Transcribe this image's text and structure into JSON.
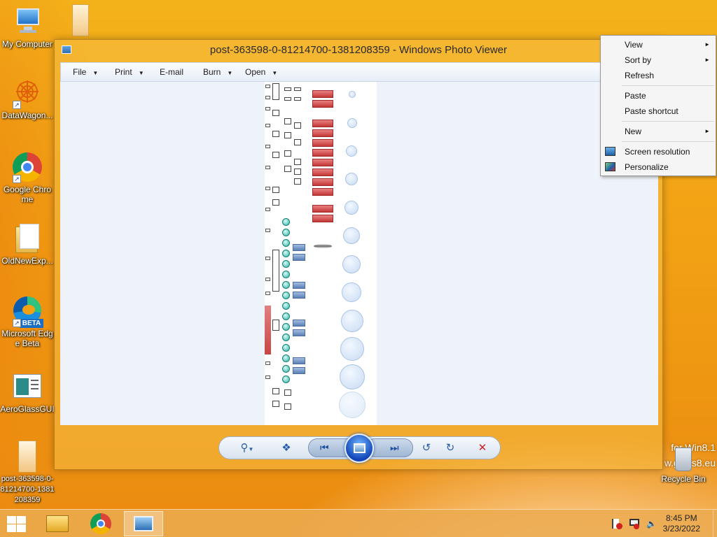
{
  "desktop": {
    "icons": [
      {
        "label": "My Computer"
      },
      {
        "label": "DataWagon..."
      },
      {
        "label": "Google Chrome"
      },
      {
        "label": "OldNewExp..."
      },
      {
        "label": "Microsoft Edge Beta",
        "badge": "BETA"
      },
      {
        "label": "AeroGlassGUI"
      },
      {
        "label": "post-363598-0-81214700-1381208359"
      }
    ],
    "recycle_bin": {
      "label": "Recycle Bin"
    },
    "watermark": {
      "line1": "for Win8.1",
      "line2": "w.glass8.eu"
    }
  },
  "photo_viewer": {
    "title": "post-363598-0-81214700-1381208359 - Windows Photo Viewer",
    "menu": {
      "file": "File",
      "print": "Print",
      "email": "E-mail",
      "burn": "Burn",
      "open": "Open"
    },
    "controls": {
      "zoom_icon": "zoom-icon",
      "actual_size_icon": "actual-size-icon",
      "previous_icon": "previous-icon",
      "slideshow_icon": "slideshow-icon",
      "next_icon": "next-icon",
      "rotate_ccw_icon": "rotate-counterclockwise-icon",
      "rotate_cw_icon": "rotate-clockwise-icon",
      "delete_icon": "delete-icon"
    }
  },
  "context_menu": {
    "view": "View",
    "sort_by": "Sort by",
    "refresh": "Refresh",
    "paste": "Paste",
    "paste_shortcut": "Paste shortcut",
    "new": "New",
    "screen_resolution": "Screen resolution",
    "personalize": "Personalize"
  },
  "taskbar": {
    "time": "8:45 PM",
    "date": "3/23/2022"
  },
  "colors": {
    "wallpaper": "#f2a114",
    "accent_blue": "#2a5da8",
    "delete_red": "#d02020"
  }
}
